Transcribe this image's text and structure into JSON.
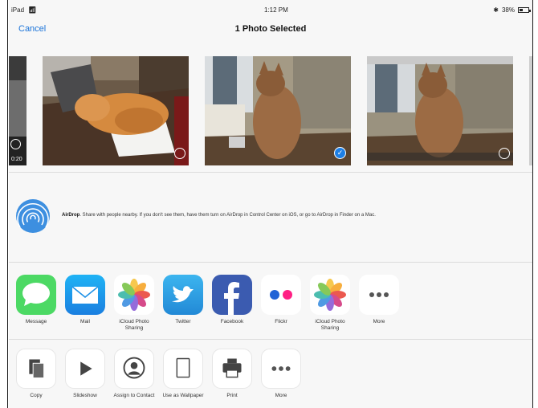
{
  "status_bar": {
    "device": "iPad",
    "time": "1:12 PM",
    "battery": "38%"
  },
  "navbar": {
    "cancel_label": "Cancel",
    "title": "1 Photo Selected"
  },
  "photos": {
    "video_duration": "0:20"
  },
  "airdrop": {
    "title": "AirDrop",
    "description": ". Share with people nearby. If you don't see them, have them turn on AirDrop in Control Center on iOS, or go to AirDrop in Finder on a Mac."
  },
  "share_apps": [
    {
      "label": "Message",
      "icon": "message-icon",
      "color": "#4cd964"
    },
    {
      "label": "Mail",
      "icon": "mail-icon",
      "color": "#1e9bf0"
    },
    {
      "label": "iCloud Photo Sharing",
      "icon": "photos-icon",
      "color": "#ffffff"
    },
    {
      "label": "Twitter",
      "icon": "twitter-icon",
      "color": "#2fa3e6"
    },
    {
      "label": "Facebook",
      "icon": "facebook-icon",
      "color": "#3b5bb0"
    },
    {
      "label": "Flickr",
      "icon": "flickr-icon",
      "color": "#ffffff"
    },
    {
      "label": "iCloud Photo Sharing",
      "icon": "photos-icon",
      "color": "#ffffff"
    },
    {
      "label": "More",
      "icon": "more-icon",
      "color": "#ffffff"
    }
  ],
  "actions": [
    {
      "label": "Copy",
      "icon": "copy-icon"
    },
    {
      "label": "Slideshow",
      "icon": "play-icon"
    },
    {
      "label": "Assign to Contact",
      "icon": "contact-icon"
    },
    {
      "label": "Use as Wallpaper",
      "icon": "wallpaper-icon"
    },
    {
      "label": "Print",
      "icon": "printer-icon"
    },
    {
      "label": "More",
      "icon": "more-icon"
    }
  ],
  "colors": {
    "accent": "#1a73d9",
    "selected": "#1d7fe6",
    "airdrop": "#3d8fe0"
  }
}
